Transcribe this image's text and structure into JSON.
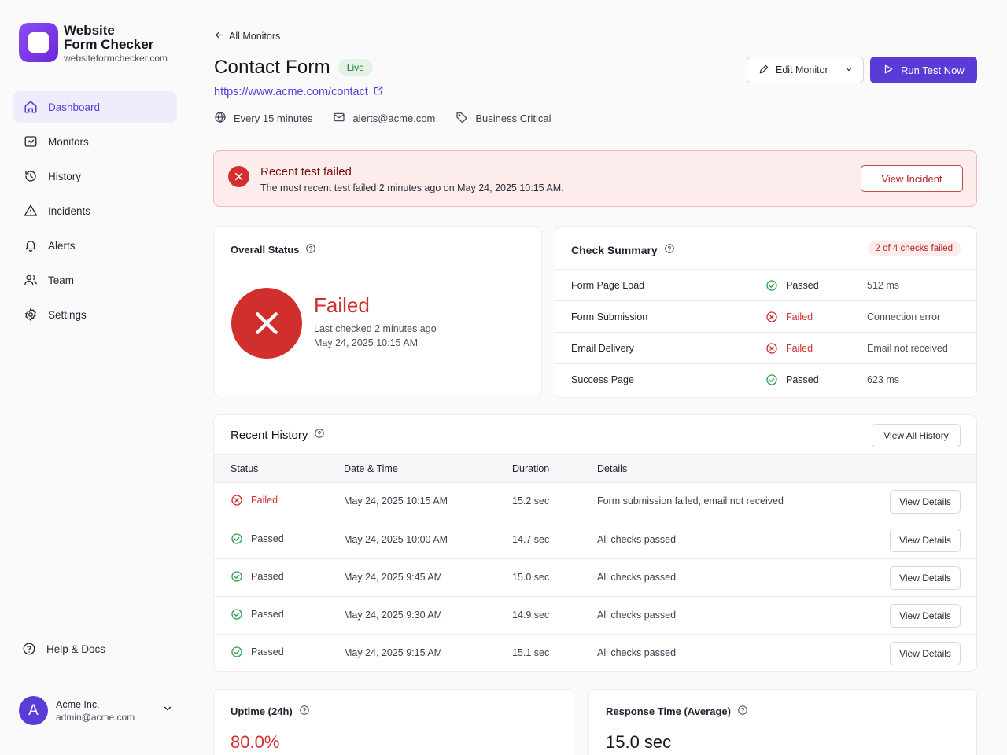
{
  "brand": {
    "title_line1": "Website",
    "title_line2": "Form Checker",
    "domain": "websiteformchecker.com"
  },
  "colors": {
    "accent": "#5b3bd6",
    "danger": "#d12e2e",
    "success": "#2e9e4f"
  },
  "nav": [
    {
      "label": "Dashboard",
      "icon": "home-icon",
      "active": true
    },
    {
      "label": "Monitors",
      "icon": "monitor-icon"
    },
    {
      "label": "History",
      "icon": "history-icon"
    },
    {
      "label": "Incidents",
      "icon": "warning-icon"
    },
    {
      "label": "Alerts",
      "icon": "bell-icon"
    },
    {
      "label": "Team",
      "icon": "users-icon"
    },
    {
      "label": "Settings",
      "icon": "gear-icon"
    }
  ],
  "help": {
    "label": "Help & Docs"
  },
  "account": {
    "avatar_letter": "A",
    "name": "Acme Inc.",
    "email": "admin@acme.com"
  },
  "header": {
    "back_label": "All Monitors",
    "title": "Contact Form",
    "badge": "Live",
    "url": "https://www.acme.com/contact",
    "frequency": "Every 15 minutes",
    "alert_email": "alerts@acme.com",
    "tag": "Business Critical",
    "edit_label": "Edit Monitor",
    "run_label": "Run Test Now"
  },
  "alert": {
    "title": "Recent test failed",
    "message": "The most recent test failed 2 minutes ago on May 24, 2025 10:15 AM.",
    "button": "View Incident"
  },
  "overall": {
    "heading": "Overall Status",
    "status": "Failed",
    "last_checked": "Last checked 2 minutes ago",
    "timestamp": "May 24, 2025 10:15 AM"
  },
  "summary": {
    "heading": "Check Summary",
    "badge": "2 of 4 checks failed",
    "rows": [
      {
        "name": "Form Page Load",
        "status": "Passed",
        "value": "512 ms"
      },
      {
        "name": "Form Submission",
        "status": "Failed",
        "value": "Connection error"
      },
      {
        "name": "Email Delivery",
        "status": "Failed",
        "value": "Email not received"
      },
      {
        "name": "Success Page",
        "status": "Passed",
        "value": "623 ms"
      }
    ]
  },
  "history": {
    "heading": "Recent History",
    "view_all": "View All History",
    "columns": [
      "Status",
      "Date & Time",
      "Duration",
      "Details"
    ],
    "details_button": "View Details",
    "rows": [
      {
        "status": "Failed",
        "datetime": "May 24, 2025 10:15 AM",
        "duration": "15.2 sec",
        "details": "Form submission failed, email not received"
      },
      {
        "status": "Passed",
        "datetime": "May 24, 2025 10:00 AM",
        "duration": "14.7 sec",
        "details": "All checks passed"
      },
      {
        "status": "Passed",
        "datetime": "May 24, 2025 9:45 AM",
        "duration": "15.0 sec",
        "details": "All checks passed"
      },
      {
        "status": "Passed",
        "datetime": "May 24, 2025 9:30 AM",
        "duration": "14.9 sec",
        "details": "All checks passed"
      },
      {
        "status": "Passed",
        "datetime": "May 24, 2025 9:15 AM",
        "duration": "15.1 sec",
        "details": "All checks passed"
      }
    ]
  },
  "uptime": {
    "heading": "Uptime (24h)",
    "value": "80.0%"
  },
  "response": {
    "heading": "Response Time (Average)",
    "value": "15.0 sec"
  }
}
